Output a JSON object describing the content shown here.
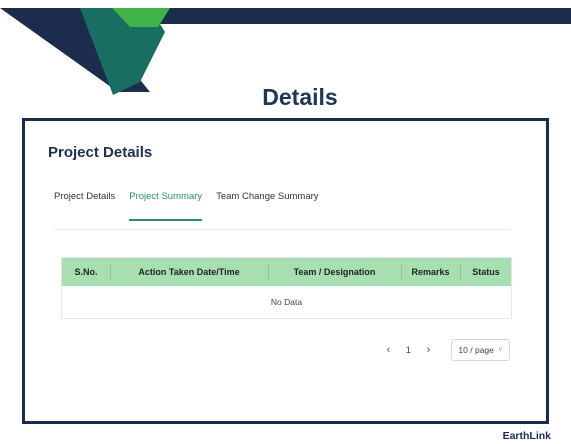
{
  "page": {
    "heading": "Details",
    "brand": "EarthLink"
  },
  "card": {
    "title": "Project Details",
    "tabs": [
      {
        "label": "Project Details",
        "active": false
      },
      {
        "label": "Project Summary",
        "active": true
      },
      {
        "label": "Team Change Summary",
        "active": false
      }
    ]
  },
  "table": {
    "columns": [
      "S.No.",
      "Action Taken Date/Time",
      "Team / Designation",
      "Remarks",
      "Status"
    ],
    "empty_text": "No Data"
  },
  "pagination": {
    "prev_icon": "‹",
    "current_page": "1",
    "next_icon": "›",
    "page_size": "10 / page"
  },
  "colors": {
    "navy": "#1c2c4c",
    "teal": "#176e61",
    "green": "#3fb24a",
    "table_header": "#a8dfb0",
    "active_tab": "#2f8f6a"
  }
}
